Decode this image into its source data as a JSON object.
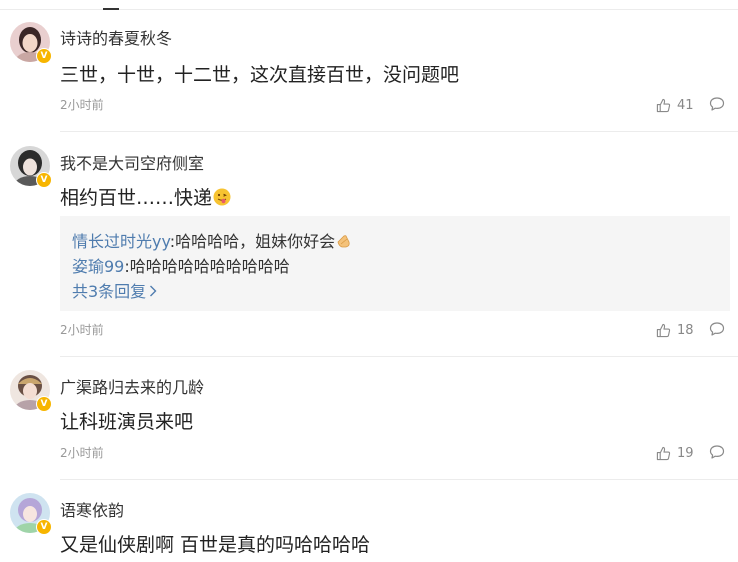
{
  "comments": [
    {
      "username": "诗诗的春夏秋冬",
      "text": "三世，十世，十二世，这次直接百世，没问题吧",
      "time": "2小时前",
      "likes": "41",
      "badge": "V"
    },
    {
      "username": "我不是大司空府侧室",
      "text": "相约百世……快递",
      "time": "2小时前",
      "likes": "18",
      "badge": "V",
      "replies": [
        {
          "user": "情长过时光yy",
          "sep": ":",
          "text": "哈哈哈哈，姐妹你好会"
        },
        {
          "user": "姿瑜99",
          "sep": ":",
          "text": "哈哈哈哈哈哈哈哈哈哈"
        }
      ],
      "more_replies_label": "共3条回复"
    },
    {
      "username": "广渠路归去来的几龄",
      "text": "让科班演员来吧",
      "time": "2小时前",
      "likes": "19",
      "badge": "V"
    },
    {
      "username": "语寒依韵",
      "text": "又是仙侠剧啊 百世是真的吗哈哈哈哈",
      "badge": "V"
    }
  ],
  "colors": {
    "reply_user": "#4f7cae",
    "badge": "#f7b500",
    "meta": "#999999",
    "reply_bg": "#f5f5f5"
  }
}
